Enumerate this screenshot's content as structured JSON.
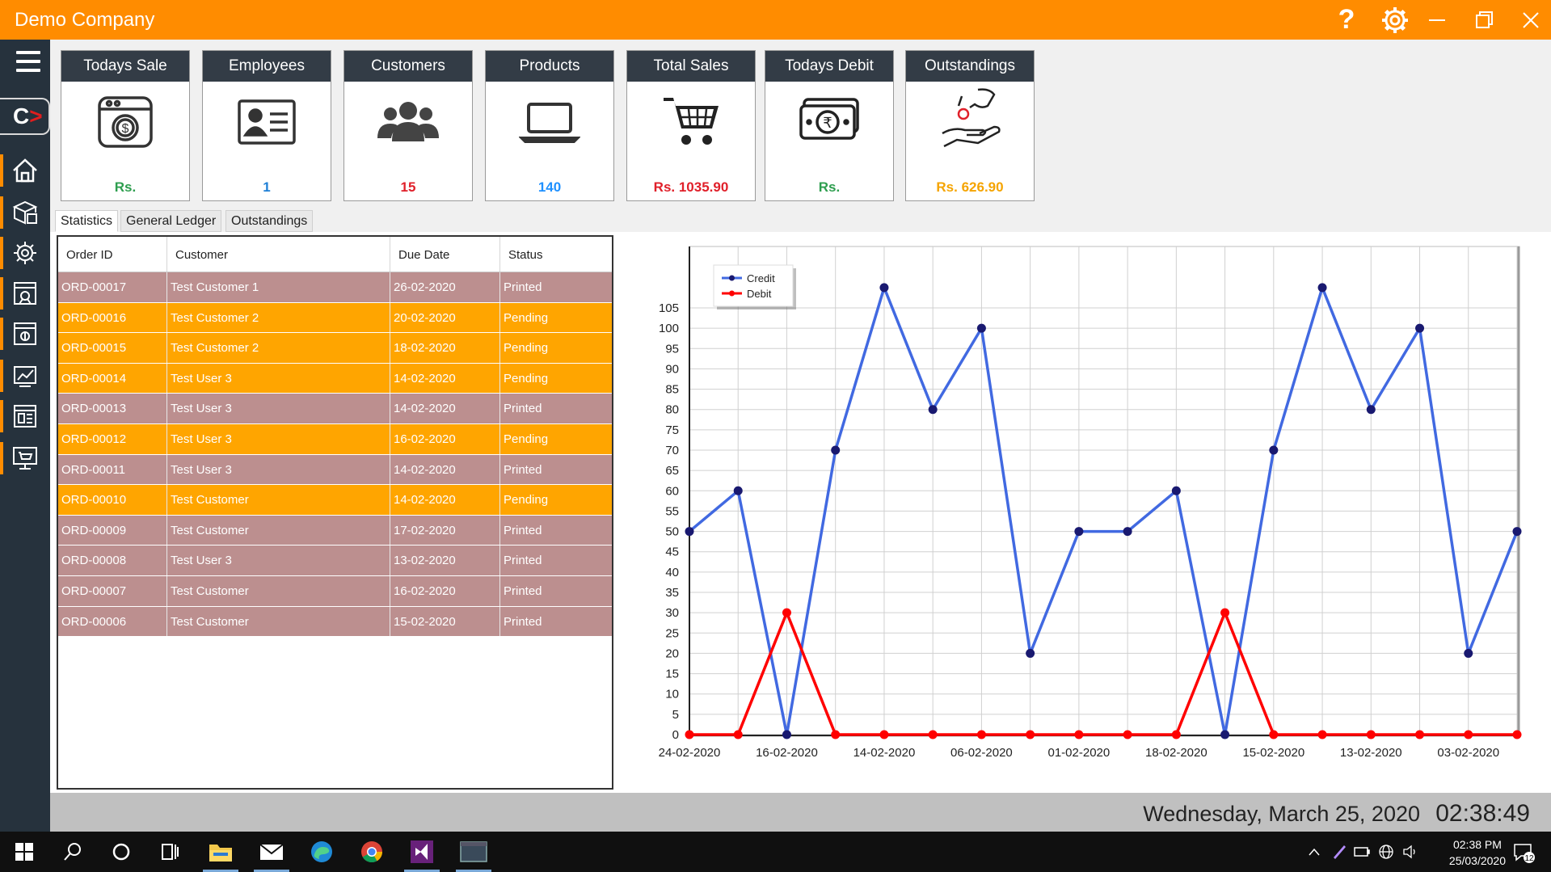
{
  "window": {
    "title": "Demo Company"
  },
  "cards": [
    {
      "title": "Todays Sale",
      "icon": "safe-icon",
      "value": "Rs.",
      "color": "#2e9e4f"
    },
    {
      "title": "Employees",
      "icon": "id-card-icon",
      "value": "1",
      "color": "#1e7fd6"
    },
    {
      "title": "Customers",
      "icon": "users-icon",
      "value": "15",
      "color": "#e0202a"
    },
    {
      "title": "Products",
      "icon": "laptop-icon",
      "value": "140",
      "color": "#1e90ff"
    },
    {
      "title": "Total Sales",
      "icon": "cart-icon",
      "value": "Rs. 1035.90",
      "color": "#e0202a"
    },
    {
      "title": "Todays Debit",
      "icon": "rupee-cash-icon",
      "value": "Rs.",
      "color": "#2e9e4f"
    },
    {
      "title": "Outstandings",
      "icon": "hand-coin-icon",
      "value": "Rs. 626.90",
      "color": "#f5a400"
    }
  ],
  "tabs": [
    "Statistics",
    "General Ledger",
    "Outstandings"
  ],
  "table": {
    "columns": [
      "Order ID",
      "Customer",
      "Due Date",
      "Status"
    ],
    "rows": [
      {
        "id": "ORD-00017",
        "customer": "Test Customer 1",
        "due": "26-02-2020",
        "status": "Printed"
      },
      {
        "id": "ORD-00016",
        "customer": "Test Customer 2",
        "due": "20-02-2020",
        "status": "Pending"
      },
      {
        "id": "ORD-00015",
        "customer": "Test Customer 2",
        "due": "18-02-2020",
        "status": "Pending"
      },
      {
        "id": "ORD-00014",
        "customer": "Test User 3",
        "due": "14-02-2020",
        "status": "Pending"
      },
      {
        "id": "ORD-00013",
        "customer": "Test User 3",
        "due": "14-02-2020",
        "status": "Printed"
      },
      {
        "id": "ORD-00012",
        "customer": "Test User 3",
        "due": "16-02-2020",
        "status": "Pending"
      },
      {
        "id": "ORD-00011",
        "customer": "Test User 3",
        "due": "14-02-2020",
        "status": "Printed"
      },
      {
        "id": "ORD-00010",
        "customer": "Test Customer",
        "due": "14-02-2020",
        "status": "Pending"
      },
      {
        "id": "ORD-00009",
        "customer": "Test Customer",
        "due": "17-02-2020",
        "status": "Printed"
      },
      {
        "id": "ORD-00008",
        "customer": "Test User 3",
        "due": "13-02-2020",
        "status": "Printed"
      },
      {
        "id": "ORD-00007",
        "customer": "Test Customer",
        "due": "16-02-2020",
        "status": "Printed"
      },
      {
        "id": "ORD-00006",
        "customer": "Test Customer",
        "due": "15-02-2020",
        "status": "Printed"
      }
    ]
  },
  "chart_data": {
    "type": "line",
    "x_tick_labels": [
      "24-02-2020",
      "16-02-2020",
      "14-02-2020",
      "06-02-2020",
      "01-02-2020",
      "18-02-2020",
      "15-02-2020",
      "13-02-2020",
      "03-02-2020"
    ],
    "x_count": 18,
    "ylim": [
      0,
      105
    ],
    "y_ticks": [
      0,
      5,
      10,
      15,
      20,
      25,
      30,
      35,
      40,
      45,
      50,
      55,
      60,
      65,
      70,
      75,
      80,
      85,
      90,
      95,
      100,
      105
    ],
    "grid": true,
    "legend": "top-left",
    "series": [
      {
        "name": "Credit",
        "color": "#4169e1",
        "marker": "#191970",
        "values": [
          50,
          60,
          0,
          70,
          110,
          80,
          100,
          20,
          50,
          50,
          60,
          0,
          70,
          110,
          80,
          100,
          20,
          50
        ]
      },
      {
        "name": "Debit",
        "color": "#ff0000",
        "marker": "#ff0000",
        "values": [
          0,
          0,
          30,
          0,
          0,
          0,
          0,
          0,
          0,
          0,
          0,
          30,
          0,
          0,
          0,
          0,
          0,
          0
        ]
      }
    ]
  },
  "status": {
    "date": "Wednesday, March 25, 2020",
    "time": "02:38:49"
  },
  "taskbar": {
    "clock_time": "02:38 PM",
    "clock_date": "25/03/2020",
    "notifications": "12"
  },
  "colors": {
    "accent": "#ff8c00",
    "sidebar": "#26323d",
    "printed": "#bc8f8f",
    "pending": "#ffa500"
  }
}
